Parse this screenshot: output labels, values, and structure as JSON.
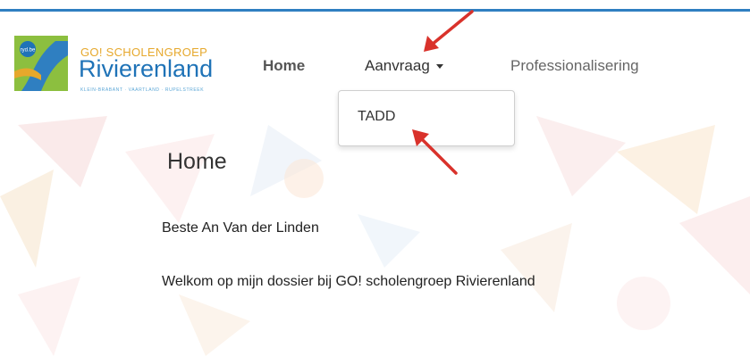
{
  "logo": {
    "badge": "ryd.be",
    "line1": "GO! SCHOLENGROEP",
    "line2": "Rivierenland",
    "line3": "KLEIN-BRABANT · VAARTLAND · RUPELSTREEK"
  },
  "nav": {
    "home": "Home",
    "aanvraag": "Aanvraag",
    "professionalisering": "Professionalisering"
  },
  "dropdown": {
    "items": [
      "TADD"
    ]
  },
  "main": {
    "title": "Home",
    "greeting": "Beste An Van der Linden",
    "welcome": "Welkom op mijn dossier bij GO! scholengroep Rivierenland"
  },
  "colors": {
    "accent": "#2f7fc1",
    "logo_blue": "#1f73b7",
    "logo_green": "#8cbf3f",
    "logo_orange": "#e6a82c",
    "annotation_red": "#d9322b"
  }
}
